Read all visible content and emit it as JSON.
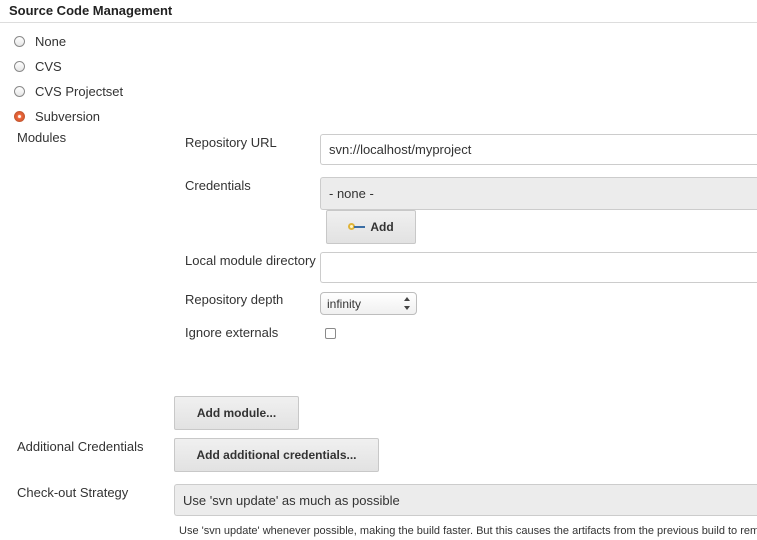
{
  "section": {
    "title": "Source Code Management"
  },
  "scm_options": [
    {
      "label": "None",
      "selected": false
    },
    {
      "label": "CVS",
      "selected": false
    },
    {
      "label": "CVS Projectset",
      "selected": false
    },
    {
      "label": "Subversion",
      "selected": true
    }
  ],
  "modules": {
    "label": "Modules",
    "repository_url": {
      "label": "Repository URL",
      "value": "svn://localhost/myproject"
    },
    "credentials": {
      "label": "Credentials",
      "value": "- none -",
      "add_label": "Add",
      "icon": "key-icon"
    },
    "local_module_directory": {
      "label": "Local module directory",
      "value": ""
    },
    "repository_depth": {
      "label": "Repository depth",
      "value": "infinity"
    },
    "ignore_externals": {
      "label": "Ignore externals",
      "checked": false
    },
    "add_module_label": "Add module..."
  },
  "additional_credentials": {
    "label": "Additional Credentials",
    "button_label": "Add additional credentials..."
  },
  "checkout_strategy": {
    "label": "Check-out Strategy",
    "value": "Use 'svn update' as much as possible",
    "help": "Use 'svn update' whenever possible, making the build faster. But this causes the artifacts from the previous build to remain w"
  },
  "colors": {
    "radio_selected": "#e8643a",
    "key_ring": "#e0b43a",
    "key_shaft": "#3b6ea5"
  }
}
